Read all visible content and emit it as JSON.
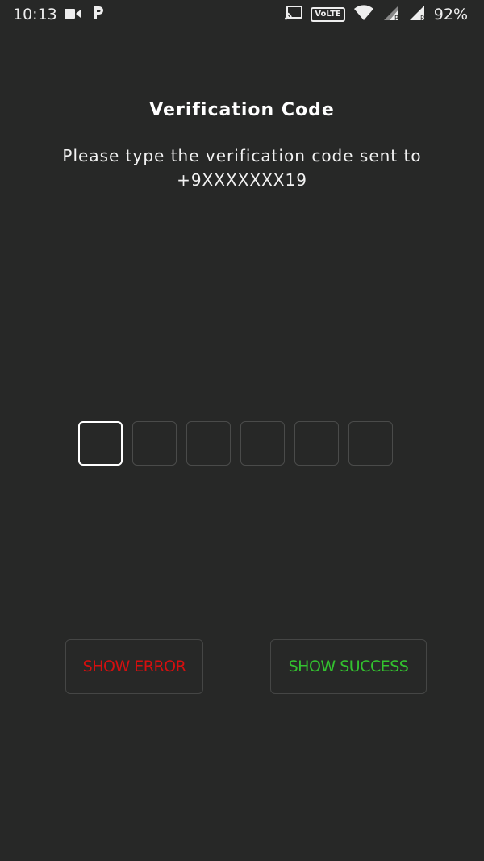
{
  "status_bar": {
    "time": "10:13",
    "volte": "VoLTE",
    "battery": "92%",
    "icons": [
      "video-camera-icon",
      "p-app-icon",
      "cast-icon",
      "wifi-icon",
      "signal-roaming-icon",
      "signal-roaming-icon"
    ]
  },
  "screen": {
    "title": "Verification Code",
    "subtitle_line1": "Please type the verification code sent to",
    "subtitle_line2": "+9XXXXXXX19"
  },
  "code_input": {
    "length": 6,
    "active_index": 0,
    "values": [
      "",
      "",
      "",
      "",
      "",
      ""
    ]
  },
  "buttons": {
    "show_error": "SHOW ERROR",
    "show_success": "SHOW SUCCESS"
  },
  "colors": {
    "background": "#272827",
    "error": "#d40f0f",
    "success": "#33c22f",
    "box_border": "#4a4b4a",
    "box_active_border": "#ffffff"
  }
}
